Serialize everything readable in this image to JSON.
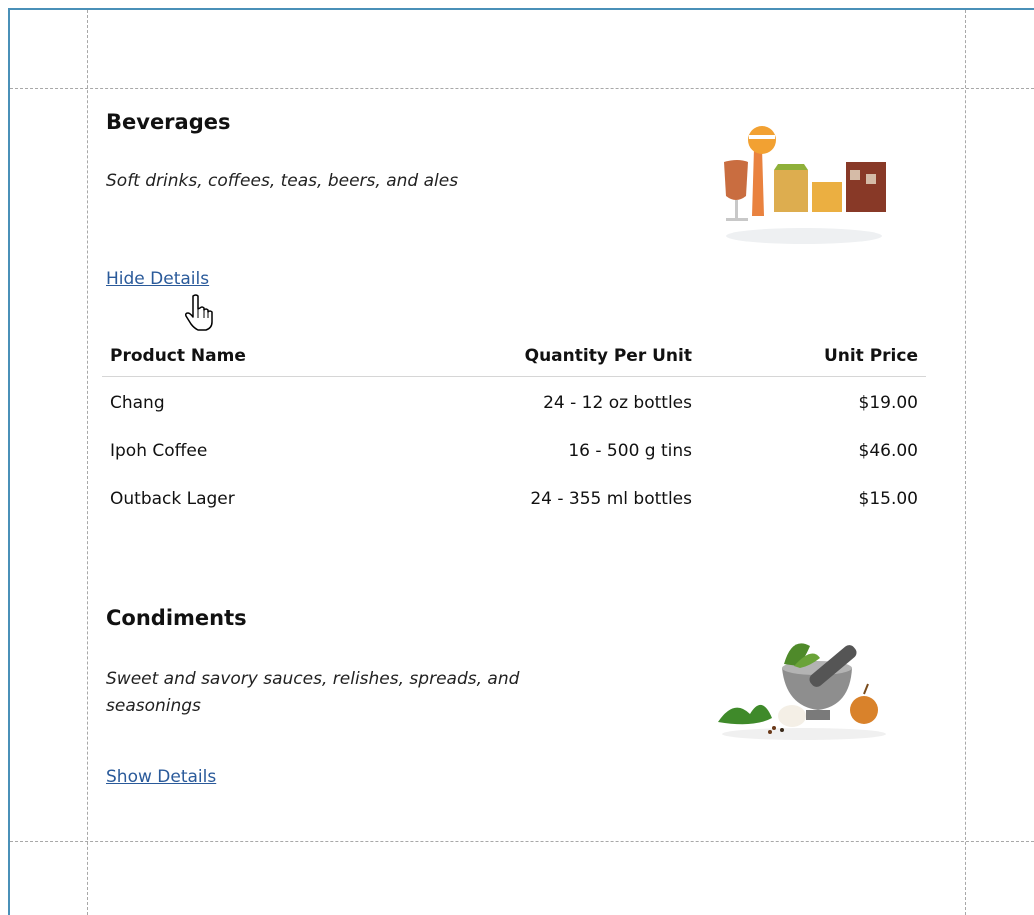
{
  "categories": [
    {
      "name": "Beverages",
      "description": "Soft drinks, coffees, teas, beers, and ales",
      "details_link": "Hide Details",
      "image_icon": "beverage-glasses-icon",
      "table": {
        "headers": [
          "Product Name",
          "Quantity Per Unit",
          "Unit Price"
        ],
        "rows": [
          [
            "Chang",
            "24 - 12 oz bottles",
            "$19.00"
          ],
          [
            "Ipoh Coffee",
            "16 - 500 g tins",
            "$46.00"
          ],
          [
            "Outback Lager",
            "24 - 355 ml bottles",
            "$15.00"
          ]
        ]
      }
    },
    {
      "name": "Condiments",
      "description": "Sweet and savory sauces, relishes, spreads, and seasonings",
      "details_link": "Show Details",
      "image_icon": "mortar-pestle-icon"
    }
  ],
  "colors": {
    "frame_border": "#4a90b8",
    "link": "#2a5a9a",
    "guide": "#a8a8a8"
  },
  "cursor_icon": "hand-pointer-icon"
}
